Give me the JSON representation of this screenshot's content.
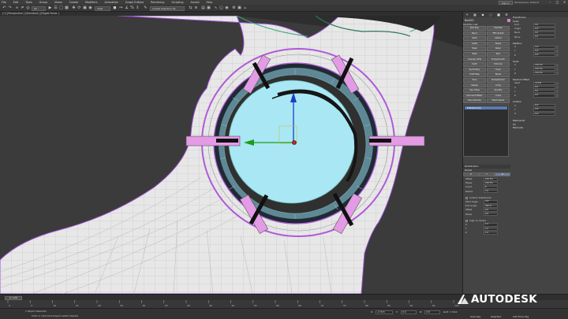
{
  "menubar": {
    "items": [
      "File",
      "Edit",
      "Tools",
      "Group",
      "Views",
      "Create",
      "Modifiers",
      "Animation",
      "Graph Editors",
      "Rendering",
      "Scripting",
      "Arnold",
      "Help"
    ],
    "sign_in": "Sign In",
    "workspace": "Workspaces: Default"
  },
  "toolbar": {
    "selection_set": "Create Selection Se",
    "view_dropdown": "View"
  },
  "viewport": {
    "label": "[+] [Perspective ] [Standard ] [Edged Faces ]"
  },
  "panel": {
    "object_name": "Box001",
    "modifier_list_label": "Modifier List",
    "modifier_buttons": [
      "Edit Poly",
      "Chamfer",
      "Bend",
      "FFD 4x4x4",
      "Shell",
      "Lattice",
      "Lathe",
      "Noise",
      "Taper",
      "Relax",
      "Twist",
      "Skin",
      "Unwrap UVW",
      "Turbosmooth",
      "Cloth",
      "Extrude",
      "Symmetry",
      "Push",
      "UVW Map",
      "Bevel",
      "Slice",
      "ProOptimizer",
      "Sweep",
      "Array",
      "Cap Holes",
      "Quadify",
      "Garment Maker",
      "Cross",
      "Face Extrude",
      "Mesh Select"
    ],
    "stack_item": "Editable Poly"
  },
  "transforms": {
    "title": "Transforms",
    "scale_label": "Scale",
    "grid": "Grid",
    "angle": "Angle",
    "bend": "Bend",
    "move": "Move",
    "axis_x": "X",
    "axis_y": "Y",
    "axis_z": "Z",
    "val_zero": "0.0",
    "val_zero_deg": "0.0°",
    "val_100": "100.0%",
    "random_offset": "Random Offset",
    "rotation": "Rotation",
    "scale": "Scale",
    "seed": "Seed",
    "seed_value": "12345",
    "uniform": "Uniform"
  },
  "distribution": {
    "title": "Distribution",
    "mode": "Radial",
    "axes": [
      "X",
      "Y",
      "Z"
    ],
    "count_label": "Count",
    "count": "6",
    "radius_label": "Radius",
    "radius": "5.0",
    "start_angle": "Start Angle",
    "start_angle_value": "0.0°",
    "end_angle": "End Angle",
    "end_angle_value": "360.0°",
    "offset": "Offset",
    "offset_value": "0.0",
    "phase": "Phase",
    "phase_value": "0.0",
    "check1": "Uniform Distribution",
    "check2": "Align to Center",
    "material_id": "Material ID",
    "uv": "UV",
    "elements": "Elements",
    "cursor_val": "1.0"
  },
  "timeline": {
    "frame": "0 / 100",
    "ticks": [
      "0",
      "5",
      "10",
      "15",
      "20",
      "25",
      "30",
      "35",
      "40",
      "45",
      "50",
      "55",
      "60",
      "65",
      "70",
      "75",
      "80",
      "85",
      "90",
      "95",
      "100"
    ]
  },
  "status": {
    "line1": "1 Object Selected",
    "line2": "Click or click-and-drag to select objects",
    "x": "X:",
    "y": "Y:",
    "z": "Z:",
    "x_val": "-2.315",
    "y_val": "0.0",
    "z_val": "2.8",
    "grid": "Grid = 10.0",
    "add_tag": "Add Time Tag",
    "autokey": "Auto Key",
    "selected": "Selected"
  },
  "brand": {
    "name": "AUTODESK"
  },
  "colors": {
    "accent": "#d580d6",
    "disc": "#a9e7f4",
    "viewport_bg": "#3a3a3a",
    "wire_magenta": "#b05ad8"
  }
}
